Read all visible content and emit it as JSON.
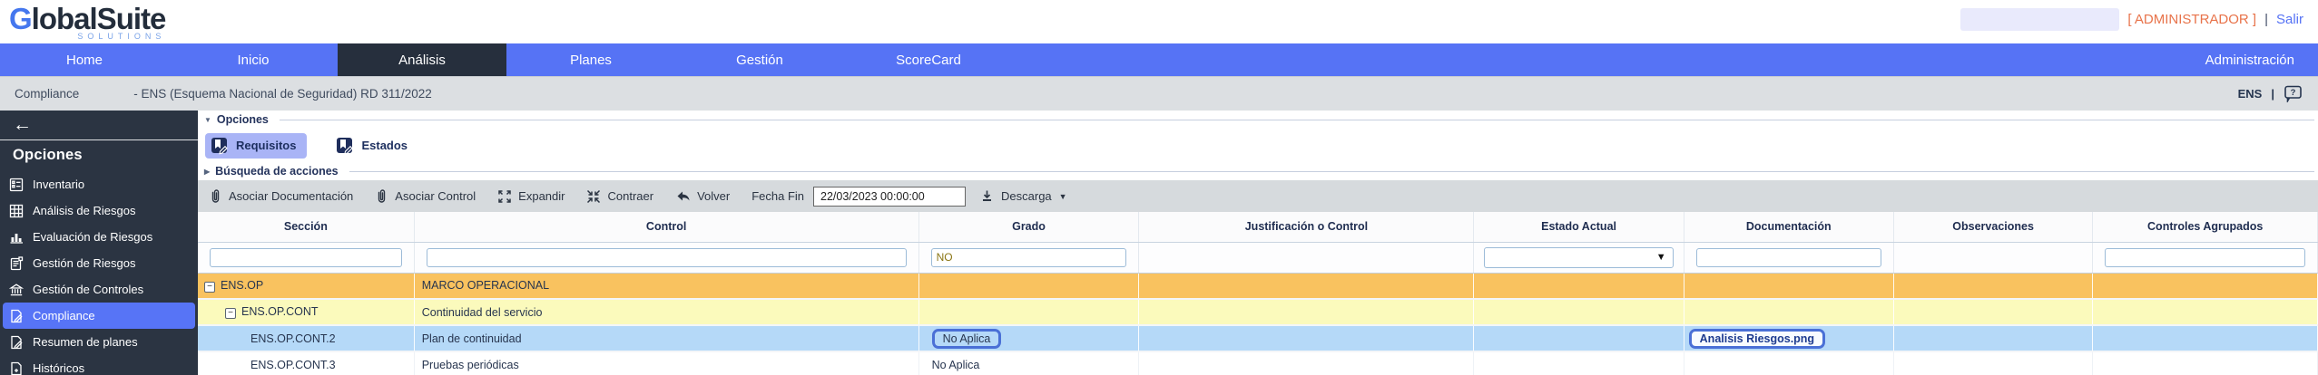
{
  "header": {
    "logo_main": "GlobalSuite",
    "logo_sub": "SOLUTIONS",
    "admin_label": "[ ADMINISTRADOR ]",
    "separator": "|",
    "logout_label": "Salir"
  },
  "nav": {
    "items": [
      "Home",
      "Inicio",
      "Análisis",
      "Planes",
      "Gestión",
      "ScoreCard"
    ],
    "active_item": "Análisis",
    "right_item": "Administración"
  },
  "breadcrumb": {
    "section": "Compliance",
    "title": "- ENS (Esquema Nacional de Seguridad) RD 311/2022",
    "right_label": "ENS",
    "separator": "|"
  },
  "sidebar": {
    "title": "Opciones",
    "items": [
      {
        "label": "Inventario",
        "icon": "clipboard-list-icon"
      },
      {
        "label": "Análisis de Riesgos",
        "icon": "grid-icon"
      },
      {
        "label": "Evaluación de Riesgos",
        "icon": "bar-chart-icon"
      },
      {
        "label": "Gestión de Riesgos",
        "icon": "report-icon"
      },
      {
        "label": "Gestión de Controles",
        "icon": "bank-icon"
      },
      {
        "label": "Compliance",
        "icon": "doc-pencil-icon",
        "active": true
      },
      {
        "label": "Resumen de planes",
        "icon": "doc-pencil-icon"
      },
      {
        "label": "Históricos",
        "icon": "doc-plus-icon"
      }
    ]
  },
  "panel": {
    "options_header": "Opciones",
    "search_header": "Búsqueda de acciones",
    "tabs": [
      {
        "label": "Requisitos",
        "active": true
      },
      {
        "label": "Estados",
        "active": false
      }
    ]
  },
  "toolbar": {
    "buttons": [
      {
        "label": "Asociar Documentación",
        "icon": "paperclip-icon"
      },
      {
        "label": "Asociar Control",
        "icon": "paperclip-icon"
      },
      {
        "label": "Expandir",
        "icon": "expand-icon"
      },
      {
        "label": "Contraer",
        "icon": "contract-icon"
      },
      {
        "label": "Volver",
        "icon": "undo-icon"
      }
    ],
    "fecha_fin_label": "Fecha Fin",
    "fecha_fin_value": "22/03/2023 00:00:00",
    "descarga_label": "Descarga"
  },
  "table": {
    "columns": [
      "Sección",
      "Control",
      "Grado",
      "Justificación o Control",
      "Estado Actual",
      "Documentación",
      "Observaciones",
      "Controles Agrupados"
    ],
    "filters": {
      "seccion": "",
      "control": "",
      "grado": "NO",
      "documentacion": "",
      "controles_agrupados": ""
    },
    "rows": [
      {
        "seccion": "ENS.OP",
        "control": "MARCO OPERACIONAL",
        "grado": "",
        "documentacion": ""
      },
      {
        "seccion": "ENS.OP.CONT",
        "control": "Continuidad del servicio",
        "grado": "",
        "documentacion": ""
      },
      {
        "seccion": "ENS.OP.CONT.2",
        "control": "Plan de continuidad",
        "grado": "No Aplica",
        "documentacion": "Analisis Riesgos.png"
      },
      {
        "seccion": "ENS.OP.CONT.3",
        "control": "Pruebas periódicas",
        "grado": "No Aplica",
        "documentacion": ""
      }
    ]
  },
  "icons": {
    "collapse_glyph": "−",
    "section_open": "▼",
    "section_closed": "▶",
    "dropdown_chevron": "▼",
    "select_chevron": "▼",
    "back_arrow": "←",
    "help_glyph": "?"
  },
  "colors": {
    "accent_blue": "#5673f5",
    "dark_navy": "#2b3442",
    "active_tab_bg": "#a9b4f6",
    "row_orange": "#f9c25f",
    "row_yellow": "#fbfabc",
    "row_blue": "#b5d9f8",
    "badge_border": "#4a70d6",
    "admin_orange": "#e8734a"
  }
}
